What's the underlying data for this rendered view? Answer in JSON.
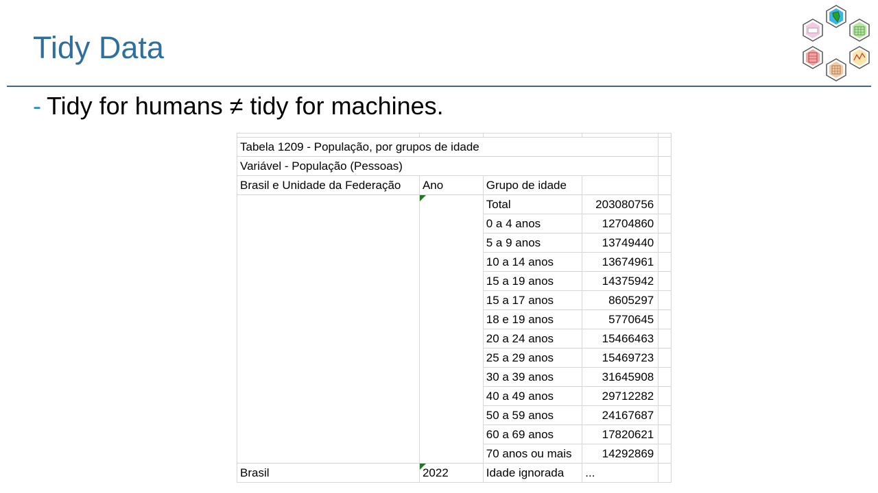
{
  "slide": {
    "title": "Tidy Data",
    "bullet_dash": "-",
    "bullet_text": "Tidy for humans ≠ tidy for machines."
  },
  "colors": {
    "title": "#2e6f9e",
    "rule": "#44648a",
    "bullet_dash": "#2e8fc4",
    "flag": "#1e7a1e",
    "logo_pink": "#f6c9e3",
    "logo_blue": "#38b6e8",
    "logo_green": "#b8e6a3",
    "logo_yellow": "#f8e7a8",
    "logo_orange": "#f3c9a6",
    "logo_red": "#f1a5a5"
  },
  "logo": {
    "icon": "hexagon-cluster-logo"
  },
  "sheet": {
    "title_row": "Tabela 1209 - População, por grupos de idade",
    "variable_row": "Variável - População (Pessoas)",
    "headers": [
      "Brasil e Unidade da Federação",
      "Ano",
      "Grupo de idade",
      ""
    ],
    "rows": [
      {
        "place": "",
        "year": "",
        "group": "Total",
        "value": "203080756"
      },
      {
        "place": "",
        "year": "",
        "group": "0 a 4 anos",
        "value": "12704860"
      },
      {
        "place": "",
        "year": "",
        "group": "5 a 9 anos",
        "value": "13749440"
      },
      {
        "place": "",
        "year": "",
        "group": "10 a 14 anos",
        "value": "13674961"
      },
      {
        "place": "",
        "year": "",
        "group": "15 a 19 anos",
        "value": "14375942"
      },
      {
        "place": "",
        "year": "",
        "group": "15 a 17 anos",
        "value": "8605297"
      },
      {
        "place": "",
        "year": "",
        "group": "18 e 19 anos",
        "value": "5770645"
      },
      {
        "place": "",
        "year": "",
        "group": "20 a 24 anos",
        "value": "15466463"
      },
      {
        "place": "",
        "year": "",
        "group": "25 a 29 anos",
        "value": "15469723"
      },
      {
        "place": "",
        "year": "",
        "group": "30 a 39 anos",
        "value": "31645908"
      },
      {
        "place": "",
        "year": "",
        "group": "40 a 49 anos",
        "value": "29712282"
      },
      {
        "place": "",
        "year": "",
        "group": "50 a 59 anos",
        "value": "24167687"
      },
      {
        "place": "",
        "year": "",
        "group": "60 a 69 anos",
        "value": "17820621"
      },
      {
        "place": "",
        "year": "",
        "group": "70 anos ou mais",
        "value": "14292869"
      },
      {
        "place": "Brasil",
        "year": "2022",
        "group": "Idade ignorada",
        "value": "..."
      }
    ]
  }
}
